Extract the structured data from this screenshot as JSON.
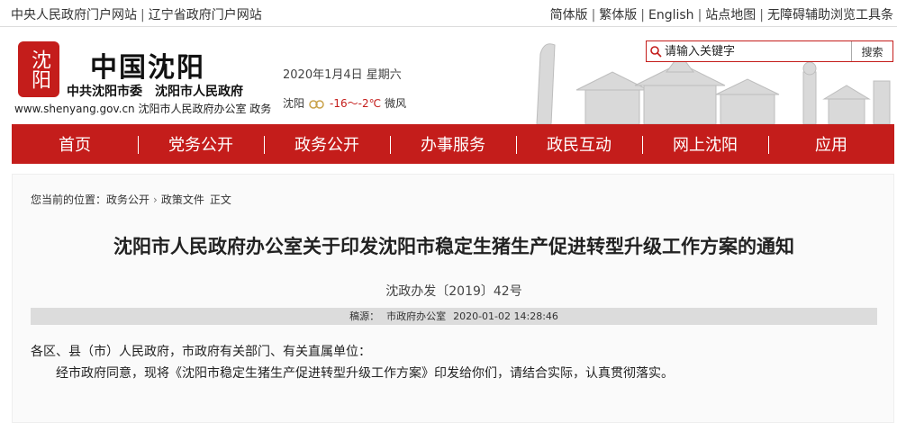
{
  "topbar": {
    "left_links": [
      "中央人民政府门户网站",
      "辽宁省政府门户网站"
    ],
    "right_links": [
      "简体版",
      "繁体版",
      "English",
      "站点地图",
      "无障碍辅助浏览工具条"
    ]
  },
  "header": {
    "seal_text": "沈阳",
    "title": "中国沈阳",
    "subtitle": "中共沈阳市委　沈阳市人民政府",
    "url_line": "www.shenyang.gov.cn 沈阳市人民政府办公室  政务",
    "date": "2020年1月4日  星期六",
    "weather": {
      "city": "沈阳",
      "temp": "-16～-2℃",
      "wind": "微风",
      "icon": "cloudy-icon"
    },
    "search": {
      "placeholder": "请输入关键字",
      "button": "搜索"
    }
  },
  "nav": {
    "items": [
      "首页",
      "党务公开",
      "政务公开",
      "办事服务",
      "政民互动",
      "网上沈阳",
      "应用"
    ]
  },
  "breadcrumb": {
    "prefix": "您当前的位置：",
    "items": [
      "政务公开",
      "政策文件",
      "正文"
    ]
  },
  "article": {
    "title": "沈阳市人民政府办公室关于印发沈阳市稳定生猪生产促进转型升级工作方案的通知",
    "doc_no": "沈政办发〔2019〕42号",
    "source_label": "稿源：",
    "source": "市政府办公室",
    "datetime": "2020-01-02 14:28:46",
    "para1": "各区、县（市）人民政府，市政府有关部门、有关直属单位：",
    "para2": "经市政府同意，现将《沈阳市稳定生猪生产促进转型升级工作方案》印发给你们，请结合实际，认真贯彻落实。"
  },
  "colors": {
    "brand_red": "#c41d1b"
  }
}
